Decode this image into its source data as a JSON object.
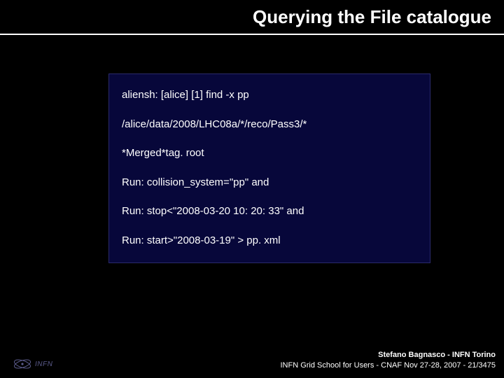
{
  "title": "Querying the File catalogue",
  "code": {
    "l1": "aliensh: [alice] [1] find -x pp",
    "l2": "/alice/data/2008/LHC08a/*/reco/Pass3/*",
    "l3": "*Merged*tag. root",
    "l4": "Run: collision_system=\"pp\" and",
    "l5": "Run: stop<\"2008-03-20 10: 20: 33\" and",
    "l6": "Run: start>\"2008-03-19\" > pp. xml"
  },
  "footer": {
    "logo_text": "INFN",
    "credit_line1": "Stefano Bagnasco - INFN Torino",
    "credit_line2": "INFN Grid School for Users - CNAF Nov 27-28, 2007 - 21/3475"
  }
}
